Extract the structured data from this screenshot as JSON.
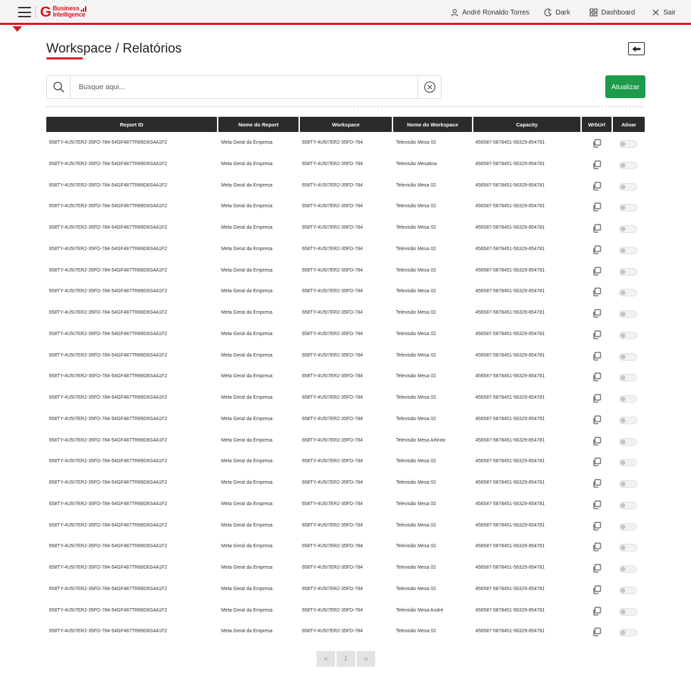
{
  "header": {
    "logo_letter": "G",
    "logo_line1": "Business",
    "logo_line2": "Intelligence",
    "user_name": "André Ronaldo Torres",
    "theme_label": "Dark",
    "dashboard_label": "Dashboard",
    "logout_label": "Sair",
    "accent_color": "#d71920"
  },
  "page": {
    "title": "Workspace / Relatórios"
  },
  "search": {
    "placeholder": "Busque aqui...",
    "value": ""
  },
  "actions": {
    "update_label": "Atualizar",
    "update_color": "#1d9a4a"
  },
  "table": {
    "columns": [
      "Report ID",
      "Nome do Report",
      "Workspace",
      "Nome do Workspace",
      "Capacity",
      "WrbUrl",
      "Ativar"
    ],
    "rows": [
      {
        "report_id": "658TY-4U5I7ER2-35FD-784-54GF487TR89D6S4A1F2",
        "report_name": "Meta Geral da Empresa",
        "workspace": "658TY-4U5I7ER2-35FD-784",
        "workspace_name": "Televisão Mesa 02",
        "capacity": "456587-5878451-56329-854781",
        "active": false
      },
      {
        "report_id": "658TY-4U5I7ER2-35FD-784-54GF487TR89D6S4A1F2",
        "report_name": "Meta Geral da Empresa",
        "workspace": "658TY-4U5I7ER2-35FD-784",
        "workspace_name": "Televisão Mesalina",
        "capacity": "456587-5878451-56329-854781",
        "active": false
      },
      {
        "report_id": "658TY-4U5I7ER2-35FD-784-54GF487TR89D6S4A1F2",
        "report_name": "Meta Geral da Empresa",
        "workspace": "658TY-4U5I7ER2-35FD-784",
        "workspace_name": "Televisão Mesa 02",
        "capacity": "456587-5878451-56329-854781",
        "active": false
      },
      {
        "report_id": "658TY-4U5I7ER2-35FD-784-54GF487TR89D6S4A1F2",
        "report_name": "Meta Geral da Empresa",
        "workspace": "658TY-4U5I7ER2-35FD-784",
        "workspace_name": "Televisão Mesa 02",
        "capacity": "456587-5878451-56329-854781",
        "active": false
      },
      {
        "report_id": "658TY-4U5I7ER2-35FD-784-54GF487TR89D6S4A1F2",
        "report_name": "Meta Geral da Empresa",
        "workspace": "658TY-4U5I7ER2-35FD-784",
        "workspace_name": "Televisão Mesa 02",
        "capacity": "456587-5878451-56329-854781",
        "active": false
      },
      {
        "report_id": "658TY-4U5I7ER2-35FD-784-54GF487TR89D6S4A1F2",
        "report_name": "Meta Geral da Empresa",
        "workspace": "658TY-4U5I7ER2-35FD-784",
        "workspace_name": "Televisão Mesa 02",
        "capacity": "456587-5878451-56329-854781",
        "active": false
      },
      {
        "report_id": "658TY-4U5I7ER2-35FD-784-54GF487TR89D6S4A1F2",
        "report_name": "Meta Geral da Empresa",
        "workspace": "658TY-4U5I7ER2-35FD-784",
        "workspace_name": "Televisão Mesa 02",
        "capacity": "456587-5878451-56329-854781",
        "active": false
      },
      {
        "report_id": "658TY-4U5I7ER2-35FD-784-54GF487TR89D6S4A1F2",
        "report_name": "Meta Geral da Empresa",
        "workspace": "658TY-4U5I7ER2-35FD-784",
        "workspace_name": "Televisão Mesa 02",
        "capacity": "456587-5878451-56329-854781",
        "active": false
      },
      {
        "report_id": "658TY-4U5I7ER2-35FD-784-54GF487TR89D6S4A1F2",
        "report_name": "Meta Geral da Empresa",
        "workspace": "658TY-4U5I7ER2-35FD-784",
        "workspace_name": "Televisão Mesa 02",
        "capacity": "456587-5878451-56329-854781",
        "active": false
      },
      {
        "report_id": "658TY-4U5I7ER2-35FD-784-54GF487TR89D6S4A1F2",
        "report_name": "Meta Geral da Empresa",
        "workspace": "658TY-4U5I7ER2-35FD-784",
        "workspace_name": "Televisão Mesa 02",
        "capacity": "456587-5878451-56329-854781",
        "active": false
      },
      {
        "report_id": "658TY-4U5I7ER2-35FD-784-54GF487TR89D6S4A1F2",
        "report_name": "Meta Geral da Empresa",
        "workspace": "658TY-4U5I7ER2-35FD-784",
        "workspace_name": "Televisão Mesa 02",
        "capacity": "456587-5878451-56329-854781",
        "active": false
      },
      {
        "report_id": "658TY-4U5I7ER2-35FD-784-54GF487TR89D6S4A1F2",
        "report_name": "Meta Geral da Empresa",
        "workspace": "658TY-4U5I7ER2-35FD-784",
        "workspace_name": "Televisão Mesa 02",
        "capacity": "456587-5878451-56329-854781",
        "active": false
      },
      {
        "report_id": "658TY-4U5I7ER2-35FD-784-54GF487TR89D6S4A1F2",
        "report_name": "Meta Geral da Empresa",
        "workspace": "658TY-4U5I7ER2-35FD-784",
        "workspace_name": "Televisão Mesa 02",
        "capacity": "456587-5878451-56329-854781",
        "active": false
      },
      {
        "report_id": "658TY-4U5I7ER2-35FD-784-54GF487TR89D6S4A1F2",
        "report_name": "Meta Geral da Empresa",
        "workspace": "658TY-4U5I7ER2-35FD-784",
        "workspace_name": "Televisão Mesa 02",
        "capacity": "456587-5878451-56329-854781",
        "active": false
      },
      {
        "report_id": "658TY-4U5I7ER2-35FD-784-54GF487TR89D6S4A1F2",
        "report_name": "Meta Geral da Empresa",
        "workspace": "658TY-4U5I7ER2-35FD-784",
        "workspace_name": "Televisão Mesa Arlindo",
        "capacity": "456587-5878451-56329-854781",
        "active": false
      },
      {
        "report_id": "658TY-4U5I7ER2-35FD-784-54GF487TR89D6S4A1F2",
        "report_name": "Meta Geral da Empresa",
        "workspace": "658TY-4U5I7ER2-35FD-784",
        "workspace_name": "Televisão Mesa 02",
        "capacity": "456587-5878451-56329-854781",
        "active": false
      },
      {
        "report_id": "658TY-4U5I7ER2-35FD-784-54GF487TR89D6S4A1F2",
        "report_name": "Meta Geral da Empresa",
        "workspace": "658TY-4U5I7ER2-35FD-784",
        "workspace_name": "Televisão Mesa 02",
        "capacity": "456587-5878451-56329-854781",
        "active": false
      },
      {
        "report_id": "658TY-4U5I7ER2-35FD-784-54GF487TR89D6S4A1F2",
        "report_name": "Meta Geral da Empresa",
        "workspace": "658TY-4U5I7ER2-35FD-784",
        "workspace_name": "Televisão Mesa 02",
        "capacity": "456587-5878451-56329-854781",
        "active": false
      },
      {
        "report_id": "658TY-4U5I7ER2-35FD-784-54GF487TR89D6S4A1F2",
        "report_name": "Meta Geral da Empresa",
        "workspace": "658TY-4U5I7ER2-35FD-784",
        "workspace_name": "Televisão Mesa 02",
        "capacity": "456587-5878451-56329-854781",
        "active": false
      },
      {
        "report_id": "658TY-4U5I7ER2-35FD-784-54GF487TR89D6S4A1F2",
        "report_name": "Meta Geral da Empresa",
        "workspace": "658TY-4U5I7ER2-35FD-784",
        "workspace_name": "Televisão Mesa 02",
        "capacity": "456587-5878451-56329-854781",
        "active": false
      },
      {
        "report_id": "658TY-4U5I7ER2-35FD-784-54GF487TR89D6S4A1F2",
        "report_name": "Meta Geral da Empresa",
        "workspace": "658TY-4U5I7ER2-35FD-784",
        "workspace_name": "Televisão Mesa 02",
        "capacity": "456587-5878451-56329-854781",
        "active": false
      },
      {
        "report_id": "658TY-4U5I7ER2-35FD-784-54GF487TR89D6S4A1F2",
        "report_name": "Meta Geral da Empresa",
        "workspace": "658TY-4U5I7ER2-35FD-784",
        "workspace_name": "Televisão Mesa 02",
        "capacity": "456587-5878451-56329-854781",
        "active": false
      },
      {
        "report_id": "658TY-4U5I7ER2-35FD-784-54GF487TR89D6S4A1F2",
        "report_name": "Meta Geral da Empresa",
        "workspace": "658TY-4U5I7ER2-35FD-784",
        "workspace_name": "Televisão Mesa André",
        "capacity": "456587-5878451-56329-854781",
        "active": false
      },
      {
        "report_id": "658TY-4U5I7ER2-35FD-784-54GF487TR89D6S4A1F2",
        "report_name": "Meta Geral da Empresa",
        "workspace": "658TY-4U5I7ER2-35FD-784",
        "workspace_name": "Televisão Mesa 02",
        "capacity": "456587-5878451-56329-854781",
        "active": false
      }
    ]
  },
  "pagination": {
    "prev_label": "«",
    "current_page": "1",
    "next_label": "»"
  },
  "icons": {
    "menu": "hamburger-icon",
    "user": "user-icon",
    "theme": "moon-icon",
    "dashboard": "grid-icon",
    "logout": "close-icon",
    "back": "arrow-left-icon",
    "search": "search-icon",
    "clear": "clear-circle-icon",
    "copy": "copy-icon"
  }
}
